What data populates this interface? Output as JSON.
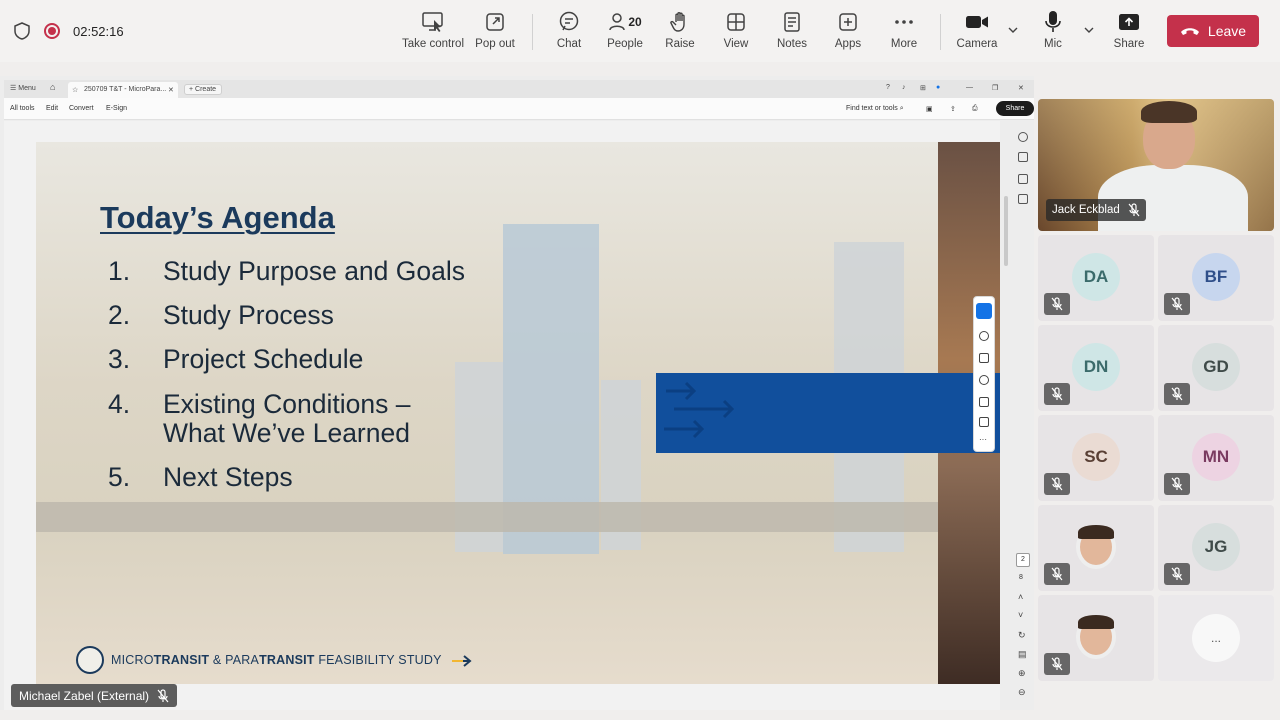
{
  "meeting": {
    "timer": "02:52:16",
    "toolbar": [
      {
        "id": "take-control",
        "label": "Take control"
      },
      {
        "id": "pop-out",
        "label": "Pop out"
      },
      {
        "id": "chat",
        "label": "Chat"
      },
      {
        "id": "people",
        "label": "People",
        "count": "20"
      },
      {
        "id": "raise",
        "label": "Raise"
      },
      {
        "id": "view",
        "label": "View"
      },
      {
        "id": "notes",
        "label": "Notes"
      },
      {
        "id": "apps",
        "label": "Apps"
      },
      {
        "id": "more",
        "label": "More"
      },
      {
        "id": "camera",
        "label": "Camera"
      },
      {
        "id": "mic",
        "label": "Mic"
      },
      {
        "id": "share",
        "label": "Share"
      }
    ],
    "leave_label": "Leave",
    "colors": {
      "leave": "#c4314b",
      "record": "#c4314b"
    }
  },
  "acrobat": {
    "menu_label": "Menu",
    "tab_title": "250709 T&T - MicroPara...",
    "create_label": "Create",
    "menu": [
      "All tools",
      "Edit",
      "Convert",
      "E-Sign"
    ],
    "find_label": "Find text or tools",
    "share_label": "Share",
    "page_current": "2",
    "page_total": "8"
  },
  "slide": {
    "title": "Today’s Agenda",
    "items": [
      {
        "num": "1.",
        "text": "Study Purpose and Goals"
      },
      {
        "num": "2.",
        "text": "Study Process"
      },
      {
        "num": "3.",
        "text": "Project Schedule"
      },
      {
        "num": "4.",
        "text": "Existing Conditions –",
        "text2": "What We’ve Learned"
      },
      {
        "num": "5.",
        "text": "Next Steps"
      }
    ],
    "footer": {
      "p1": "MICRO",
      "p2": "TRANSIT",
      "p3": " & ",
      "p4": "PARA",
      "p5": "TRANSIT",
      "p6": " FEASIBILITY STUDY"
    },
    "colors": {
      "title": "#1b3a5c",
      "banner": "#114f9c"
    }
  },
  "presenter": {
    "name": "Michael Zabel (External)"
  },
  "gallery": {
    "main_video": {
      "name": "Jack Eckblad"
    },
    "tiles": [
      {
        "initials": "DA",
        "bg": "#cfe6e6",
        "fg": "#3b6b6b"
      },
      {
        "initials": "BF",
        "bg": "#c7d6ee",
        "fg": "#2f4f8a"
      },
      {
        "initials": "DN",
        "bg": "#cfe6e6",
        "fg": "#3b6b6b"
      },
      {
        "initials": "GD",
        "bg": "#d7dedd",
        "fg": "#3f4b49"
      },
      {
        "initials": "SC",
        "bg": "#eadbd3",
        "fg": "#5a4035"
      },
      {
        "initials": "MN",
        "bg": "#edd3e2",
        "fg": "#7a3b60"
      },
      {
        "initials": "",
        "bg": "photo",
        "fg": ""
      },
      {
        "initials": "JG",
        "bg": "#d7dedd",
        "fg": "#3f4b49"
      },
      {
        "initials": "",
        "bg": "photo",
        "fg": ""
      }
    ],
    "more_label": "..."
  }
}
